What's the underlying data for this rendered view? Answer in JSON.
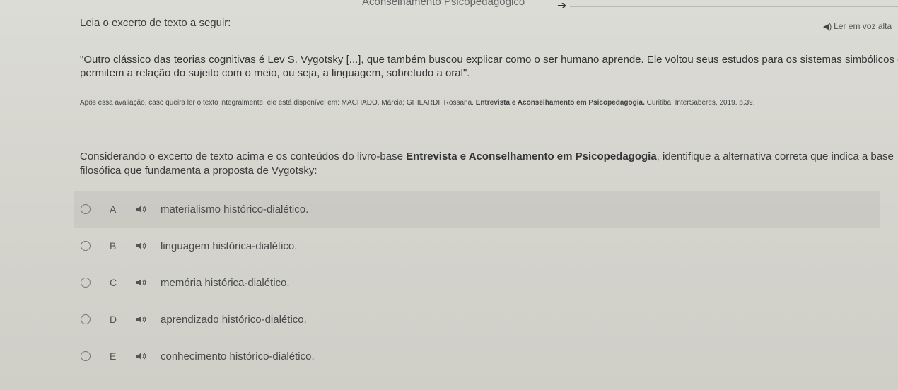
{
  "header": {
    "title": "Aconselhamento Psicopedagógico",
    "arrow": "➔"
  },
  "intro": "Leia o excerto de texto a seguir:",
  "read_aloud": "Ler em voz alta",
  "quote": {
    "line1": "\"Outro clássico das teorias cognitivas é Lev S. Vygotsky [...], que também buscou explicar como o ser humano aprende. Ele voltou seus estudos para os sistemas simbólicos que",
    "line2": "permitem a relação do sujeito com o meio, ou seja, a linguagem, sobretudo a oral\"."
  },
  "source": {
    "prefix": "Após essa avaliação, caso queira ler o texto integralmente, ele está disponível em: MACHADO, Márcia; GHILARDI, Rossana. ",
    "book": "Entrevista e Aconselhamento em Psicopedagogia.",
    "suffix": " Curitiba: InterSaberes, 2019. p.39."
  },
  "question": {
    "line1_pre": "Considerando o excerto de texto acima e os conteúdos do livro-base ",
    "line1_bold": "Entrevista e Aconselhamento em Psicopedagogia",
    "line1_post": ", identifique a alternativa correta que indica a base",
    "line2": "filosófica que fundamenta a proposta de Vygotsky:"
  },
  "options": [
    {
      "letter": "A",
      "text": "materialismo histórico-dialético."
    },
    {
      "letter": "B",
      "text": "linguagem histórica-dialético."
    },
    {
      "letter": "C",
      "text": "memória histórica-dialético."
    },
    {
      "letter": "D",
      "text": "aprendizado histórico-dialético."
    },
    {
      "letter": "E",
      "text": "conhecimento histórico-dialético."
    }
  ],
  "icons": {
    "speaker": "speaker-icon",
    "radio": "radio-circle"
  }
}
